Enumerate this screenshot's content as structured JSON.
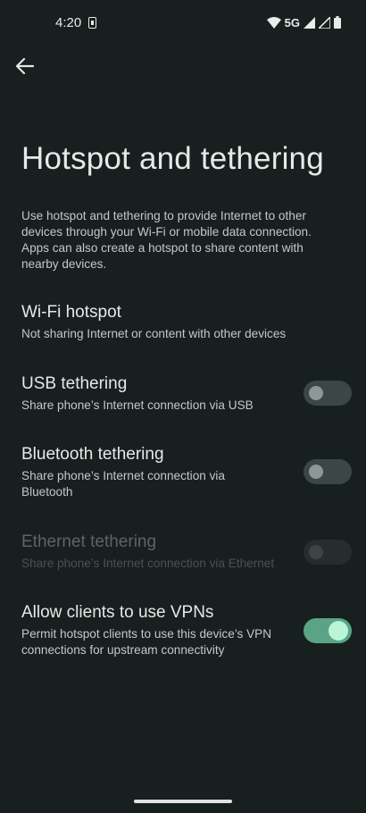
{
  "status_bar": {
    "time": "4:20",
    "network": "5G",
    "icons": [
      "sim-card-icon",
      "wifi-icon",
      "signal-icon",
      "signal-icon",
      "battery-icon"
    ]
  },
  "header": {
    "back_icon": "arrow-back-icon",
    "title": "Hotspot and tethering"
  },
  "description": "Use hotspot and tethering to provide Internet to other devices through your Wi-Fi or mobile data connection. Apps can also create a hotspot to share content with nearby devices.",
  "settings": [
    {
      "title": "Wi-Fi hotspot",
      "subtitle": "Not sharing Internet or content with other devices"
    },
    {
      "title": "USB tethering",
      "subtitle": "Share phone’s Internet connection via USB",
      "toggle": "off"
    },
    {
      "title": "Bluetooth tethering",
      "subtitle": "Share phone’s Internet connection via Bluetooth",
      "toggle": "off"
    },
    {
      "title": "Ethernet tethering",
      "subtitle": "Share phone’s Internet connection via Ethernet",
      "toggle": "off",
      "disabled": true
    },
    {
      "title": "Allow clients to use VPNs",
      "subtitle": "Permit hotspot clients to use this device’s VPN connections for upstream connectivity",
      "toggle": "on"
    }
  ],
  "colors": {
    "background": "#17201f",
    "toggle_on": "#5aa485",
    "toggle_off": "#3b4645"
  }
}
